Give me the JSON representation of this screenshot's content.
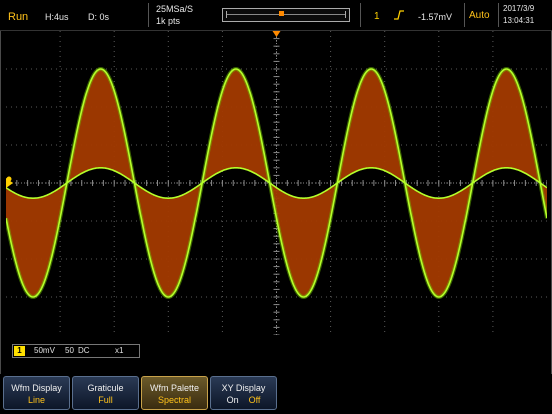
{
  "status": {
    "run_state": "Run",
    "horizontal": "H:4us",
    "delay": "D: 0s",
    "sample_rate": "25MSa/S",
    "record_length": "1k pts",
    "trigger_channel": "1",
    "trigger_edge_icon": "rising-edge-icon",
    "trigger_level": "-1.57mV",
    "trigger_mode": "Auto",
    "date": "2017/3/9",
    "time": "13:04:31"
  },
  "channel_scale": {
    "channel": "1",
    "volts_per_div": "50mV",
    "impedance": "50",
    "coupling": "DC",
    "probe": "x1"
  },
  "waveform": {
    "cycles": 4,
    "peak_divisions": 3.0,
    "inner_divisions": 0.4,
    "colors": {
      "envelope": "#b5ff2b",
      "fill": "#a33a00",
      "grid": "#5a5a5a",
      "marker": "#ffd000"
    }
  },
  "softkeys": [
    {
      "title": "Wfm Display",
      "value": "Line"
    },
    {
      "title": "Graticule",
      "value": "Full"
    },
    {
      "title": "Wfm Palette",
      "value": "Spectral"
    },
    {
      "title": "XY Display",
      "value_on": "On",
      "value_off": "Off"
    }
  ],
  "colors": {
    "accent": "#ffc21a",
    "channel1": "#ffe000"
  }
}
